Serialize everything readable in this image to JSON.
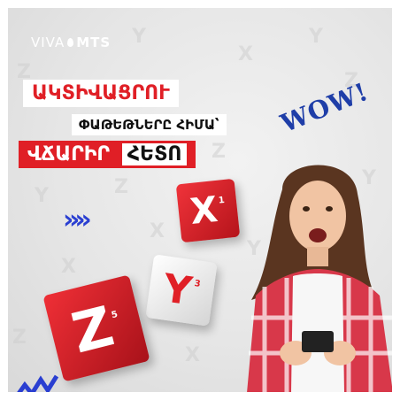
{
  "brand": {
    "name_viva": "VIVA",
    "name_mts": "MTS"
  },
  "banner": {
    "line1": "ԱԿՏԻՎԱՑՐՈՒ",
    "line2": "ՓԱԹԵԹՆԵՐԸ ՀԻՄԱ՝",
    "line3_red": "ՎՃԱՐԻՐ",
    "line3_dark": "ՀԵՏՈ"
  },
  "wow": "WOW!",
  "cubes": {
    "x_letter": "X",
    "x_sup": "1",
    "y_letter": "Y",
    "y_sup": "3",
    "z_letter": "Z",
    "z_sup": "5"
  },
  "colors": {
    "accent_red": "#e01f26",
    "accent_blue": "#2a3fd1",
    "wow_blue": "#1f3ea8"
  },
  "icons": [
    "double-chevron-right-icon",
    "zigzag-decoration-icon",
    "phone-icon"
  ]
}
